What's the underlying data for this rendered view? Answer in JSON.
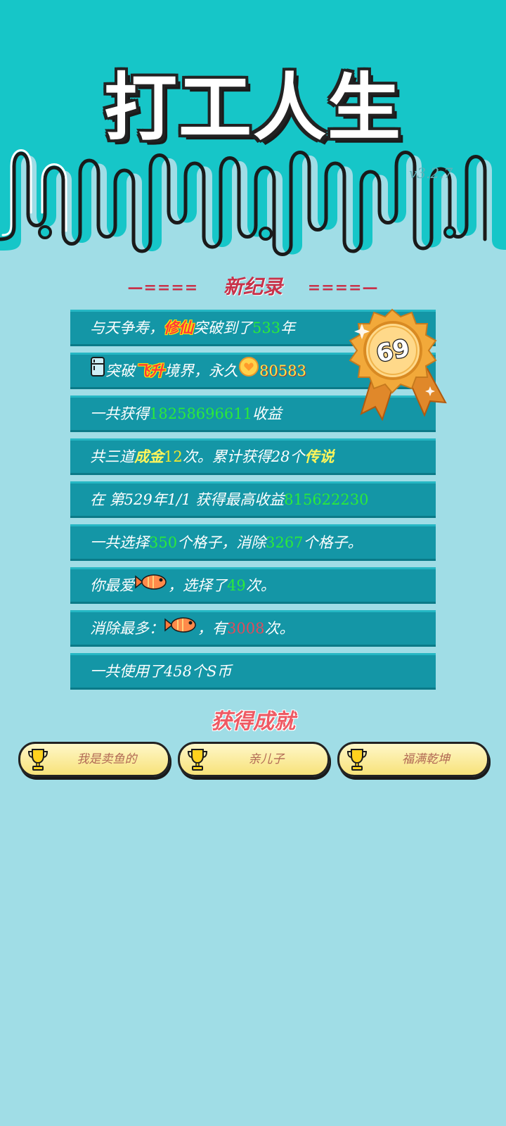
{
  "app": {
    "title": "打工人生",
    "version": "v3.2.7"
  },
  "record": {
    "title": "新纪录",
    "deco_left": "—====",
    "deco_right": "====—"
  },
  "medal": {
    "number": "69"
  },
  "stats": {
    "row1": {
      "a": "与天争寿，",
      "b": "修仙",
      "c": "突破到了",
      "d": "533",
      "e": "年"
    },
    "row2": {
      "a": "突破",
      "b": "飞升",
      "c": "境界，永久",
      "d": "80583"
    },
    "row3": {
      "a": "一共获得",
      "b": "18258696611",
      "c": "收益"
    },
    "row4": {
      "a": "共三道",
      "b": "成金",
      "c": "12",
      "d": "次。累计获得28个",
      "e": "传说"
    },
    "row5": {
      "a": "在 第529年1/1 获得最高收益",
      "b": "815622230"
    },
    "row6": {
      "a": "一共选择",
      "b": "350",
      "c": "个格子，消除",
      "d": "3267",
      "e": "个格子。"
    },
    "row7": {
      "a": "你最爱",
      "b": "，选择了",
      "c": "49",
      "d": "次。"
    },
    "row8": {
      "a": "消除最多：",
      "b": "，有",
      "c": "3008",
      "d": "次。"
    },
    "row9": {
      "a": "一共使用了458个S币"
    }
  },
  "achievements": {
    "title": "获得成就",
    "items": [
      "我是卖鱼的",
      "亲儿子",
      "福满乾坤"
    ]
  },
  "colors": {
    "header_bg": "#16c6c8",
    "page_bg": "#a0dde6",
    "row_bg": "#1496a6",
    "highlight_green": "#2bea3a",
    "highlight_yellow": "#f3e92c",
    "highlight_red": "#e24a5a"
  }
}
